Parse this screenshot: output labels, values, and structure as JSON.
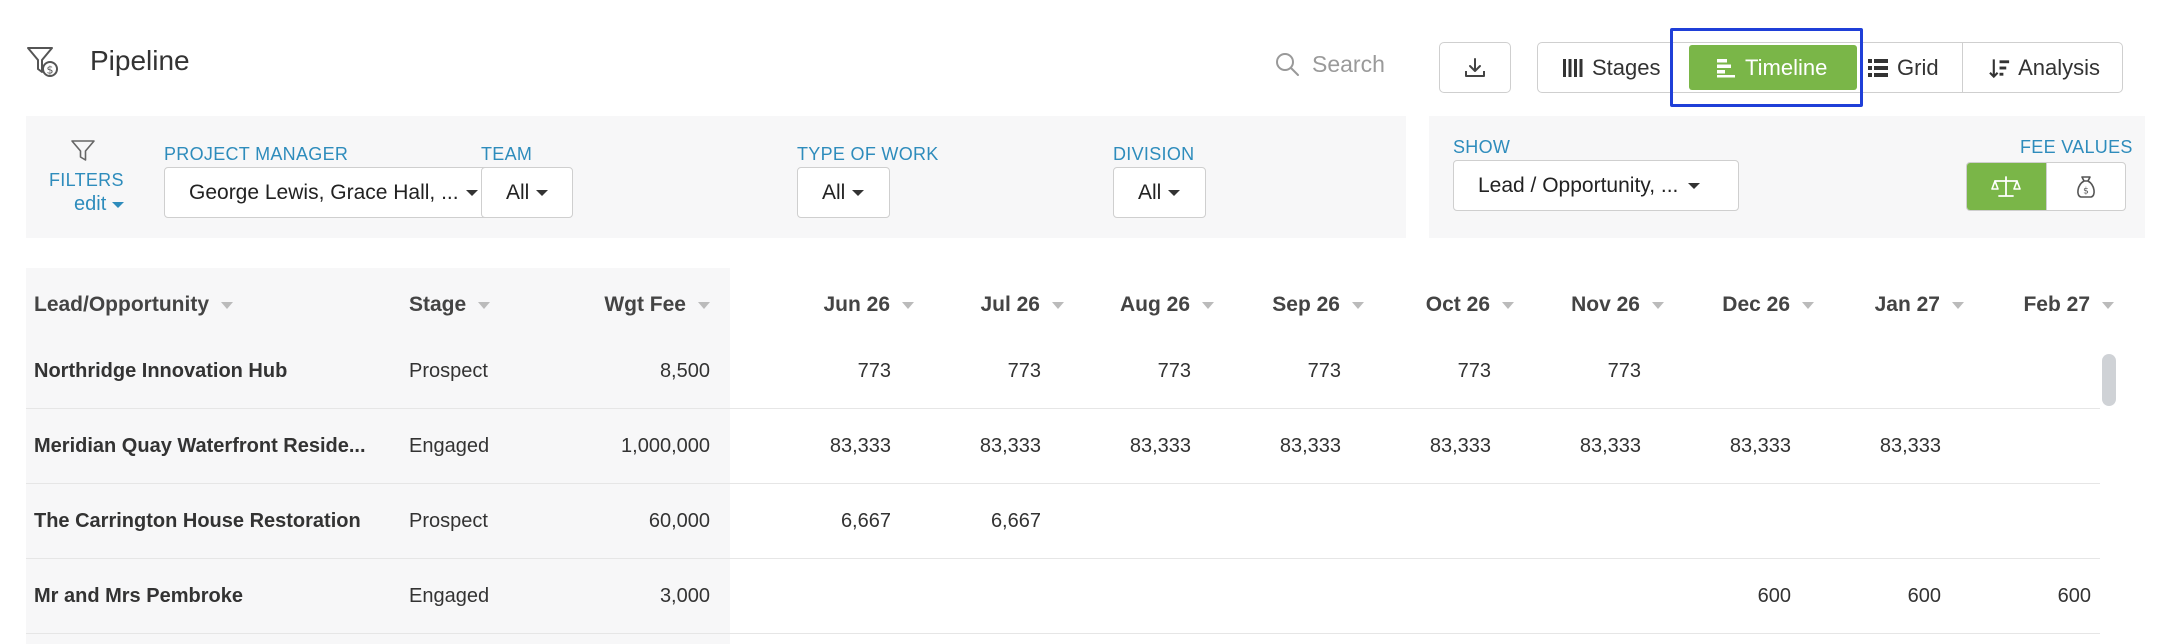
{
  "header": {
    "title": "Pipeline",
    "search_placeholder": "Search",
    "views": [
      {
        "label": "Stages"
      },
      {
        "label": "Timeline",
        "active": true
      },
      {
        "label": "Grid"
      },
      {
        "label": "Analysis"
      }
    ]
  },
  "filters": {
    "label": "FILTERS",
    "edit_label": "edit",
    "project_manager": {
      "label": "PROJECT MANAGER",
      "value": "George Lewis, Grace Hall, ..."
    },
    "team": {
      "label": "TEAM",
      "value": "All"
    },
    "type_of_work": {
      "label": "TYPE OF WORK",
      "value": "All"
    },
    "division": {
      "label": "DIVISION",
      "value": "All"
    }
  },
  "show": {
    "label": "SHOW",
    "value": "Lead / Opportunity, ..."
  },
  "fee_values": {
    "label": "FEE VALUES",
    "options": [
      "weighted-icon",
      "money-bag-icon"
    ],
    "active_index": 0
  },
  "table": {
    "columns": {
      "name": "Lead/Opportunity",
      "stage": "Stage",
      "fee": "Wgt Fee",
      "months": [
        "Jun 26",
        "Jul 26",
        "Aug 26",
        "Sep 26",
        "Oct 26",
        "Nov 26",
        "Dec 26",
        "Jan 27",
        "Feb 27"
      ]
    },
    "rows": [
      {
        "name": "Northridge Innovation Hub",
        "stage": "Prospect",
        "fee": "8,500",
        "months": [
          "773",
          "773",
          "773",
          "773",
          "773",
          "773",
          "",
          "",
          ""
        ]
      },
      {
        "name": "Meridian Quay Waterfront Reside...",
        "stage": "Engaged",
        "fee": "1,000,000",
        "months": [
          "83,333",
          "83,333",
          "83,333",
          "83,333",
          "83,333",
          "83,333",
          "83,333",
          "83,333",
          ""
        ]
      },
      {
        "name": "The Carrington House Restoration",
        "stage": "Prospect",
        "fee": "60,000",
        "months": [
          "6,667",
          "6,667",
          "",
          "",
          "",
          "",
          "",
          "",
          ""
        ]
      },
      {
        "name": "Mr and Mrs Pembroke",
        "stage": "Engaged",
        "fee": "3,000",
        "months": [
          "",
          "",
          "",
          "",
          "",
          "",
          "600",
          "600",
          "600"
        ]
      }
    ]
  },
  "colors": {
    "accent_green": "#7ab648",
    "link_blue": "#2e8cbc",
    "highlight_blue": "#1f3fd8"
  }
}
